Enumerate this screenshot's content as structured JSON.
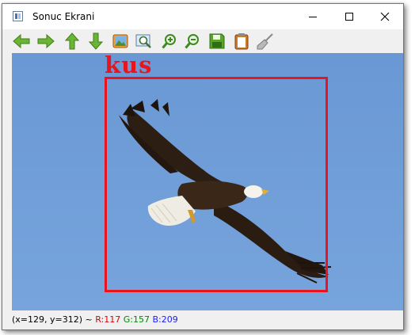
{
  "window": {
    "title": "Sonuc Ekrani"
  },
  "toolbar": {
    "buttons": [
      {
        "name": "back",
        "icon": "arrow-left-icon"
      },
      {
        "name": "forward",
        "icon": "arrow-right-icon"
      },
      {
        "name": "up",
        "icon": "arrow-up-icon"
      },
      {
        "name": "down",
        "icon": "arrow-down-icon"
      },
      {
        "name": "image",
        "icon": "picture-icon"
      },
      {
        "name": "zoom-fit",
        "icon": "zoom-fit-icon"
      },
      {
        "name": "zoom-in",
        "icon": "zoom-in-icon"
      },
      {
        "name": "zoom-out",
        "icon": "zoom-out-icon"
      },
      {
        "name": "save",
        "icon": "save-icon"
      },
      {
        "name": "copy",
        "icon": "clipboard-icon"
      },
      {
        "name": "clear",
        "icon": "broom-icon"
      }
    ]
  },
  "detection": {
    "label": "kus",
    "box_color": "#e8141e"
  },
  "status": {
    "coords": "(x=129, y=312) ~ ",
    "r": "R:117",
    "g": "G:157",
    "b": "B:209"
  },
  "colors": {
    "sky": "#6c9bd6",
    "accent_green": "#6bb536"
  }
}
